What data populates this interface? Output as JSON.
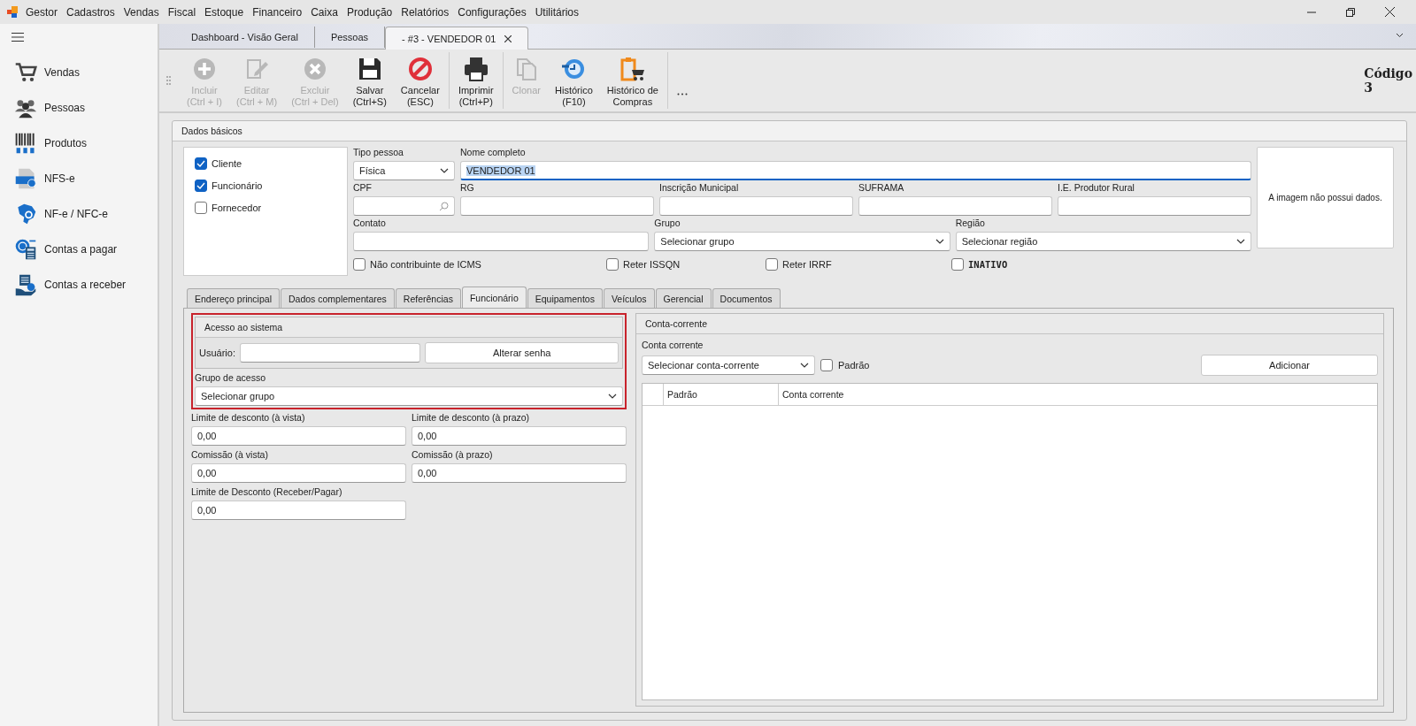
{
  "menu_bar": {
    "app_name": "Gestor",
    "items": [
      "Cadastros",
      "Vendas",
      "Fiscal",
      "Estoque",
      "Financeiro",
      "Caixa",
      "Produção",
      "Relatórios",
      "Configurações",
      "Utilitários"
    ]
  },
  "sidebar": {
    "items": [
      {
        "label": "Vendas"
      },
      {
        "label": "Pessoas"
      },
      {
        "label": "Produtos"
      },
      {
        "label": "NFS-e"
      },
      {
        "label": "NF-e / NFC-e"
      },
      {
        "label": "Contas a pagar"
      },
      {
        "label": "Contas a receber"
      }
    ]
  },
  "document_tabs": [
    {
      "label": "Dashboard - Visão Geral",
      "selected": false
    },
    {
      "label": "Pessoas",
      "selected": false
    },
    {
      "label": "- #3 - VENDEDOR 01",
      "selected": true
    }
  ],
  "toolbar": {
    "groups": [
      [
        {
          "lines": [
            "Incluir",
            "(Ctrl + I)"
          ],
          "disabled": true
        },
        {
          "lines": [
            "Editar",
            "(Ctrl + M)"
          ],
          "disabled": true
        },
        {
          "lines": [
            "Excluir",
            "(Ctrl + Del)"
          ],
          "disabled": true
        },
        {
          "lines": [
            "Salvar",
            "(Ctrl+S)"
          ],
          "disabled": false
        },
        {
          "lines": [
            "Cancelar",
            "(ESC)"
          ],
          "disabled": false
        }
      ],
      [
        {
          "lines": [
            "Imprimir",
            "(Ctrl+P)"
          ],
          "disabled": false
        }
      ],
      [
        {
          "lines": [
            "Clonar"
          ],
          "disabled": true
        },
        {
          "lines": [
            "Histórico",
            "(F10)"
          ],
          "disabled": false
        },
        {
          "lines": [
            "Histórico de",
            "Compras"
          ],
          "disabled": false
        }
      ]
    ]
  },
  "code": {
    "label": "Código",
    "value": "3"
  },
  "basic_data": {
    "title": "Dados básicos",
    "roles": [
      {
        "label": "Cliente",
        "checked": true
      },
      {
        "label": "Funcionário",
        "checked": true
      },
      {
        "label": "Fornecedor",
        "checked": false
      }
    ],
    "person_type": {
      "label": "Tipo pessoa",
      "value": "Física"
    },
    "full_name": {
      "label": "Nome completo",
      "value": "VENDEDOR 01"
    },
    "cpf": {
      "label": "CPF"
    },
    "rg": {
      "label": "RG"
    },
    "municipal_registration": {
      "label": "Inscrição Municipal"
    },
    "suframa": {
      "label": "SUFRAMA"
    },
    "rural_producer_ie": {
      "label": "I.E. Produtor Rural"
    },
    "contact": {
      "label": "Contato"
    },
    "group": {
      "label": "Grupo",
      "value": "Selecionar grupo"
    },
    "region": {
      "label": "Região",
      "value": "Selecionar região"
    },
    "flags": [
      {
        "label": "Não contribuinte de ICMS",
        "checked": false
      },
      {
        "label": "Reter ISSQN",
        "checked": false
      },
      {
        "label": "Reter IRRF",
        "checked": false
      },
      {
        "label": "INATIVO",
        "checked": false
      }
    ],
    "image_placeholder": "A imagem não possui dados."
  },
  "tabs": [
    {
      "label": "Endereço principal",
      "selected": false
    },
    {
      "label": "Dados complementares",
      "selected": false
    },
    {
      "label": "Referências",
      "selected": false
    },
    {
      "label": "Funcionário",
      "selected": true
    },
    {
      "label": "Equipamentos",
      "selected": false
    },
    {
      "label": "Veículos",
      "selected": false
    },
    {
      "label": "Gerencial",
      "selected": false
    },
    {
      "label": "Documentos",
      "selected": false
    }
  ],
  "system_access": {
    "title": "Acesso ao sistema",
    "user_label": "Usuário:",
    "change_password": "Alterar senha",
    "access_group": {
      "label": "Grupo de acesso",
      "value": "Selecionar grupo"
    }
  },
  "limits": [
    {
      "label": "Limite de desconto (à vista)",
      "value": "0,00"
    },
    {
      "label": "Limite de desconto (à prazo)",
      "value": "0,00"
    },
    {
      "label": "Comissão (à vista)",
      "value": "0,00"
    },
    {
      "label": "Comissão (à prazo)",
      "value": "0,00"
    },
    {
      "label": "Limite de Desconto (Receber/Pagar)",
      "value": "0,00"
    }
  ],
  "bank_account": {
    "title": "Conta-corrente",
    "label": "Conta corrente",
    "select_value": "Selecionar conta-corrente",
    "default_checkbox": {
      "label": "Padrão",
      "checked": false
    },
    "add_button": "Adicionar",
    "table": {
      "columns": [
        "Padrão",
        "Conta corrente"
      ]
    }
  }
}
